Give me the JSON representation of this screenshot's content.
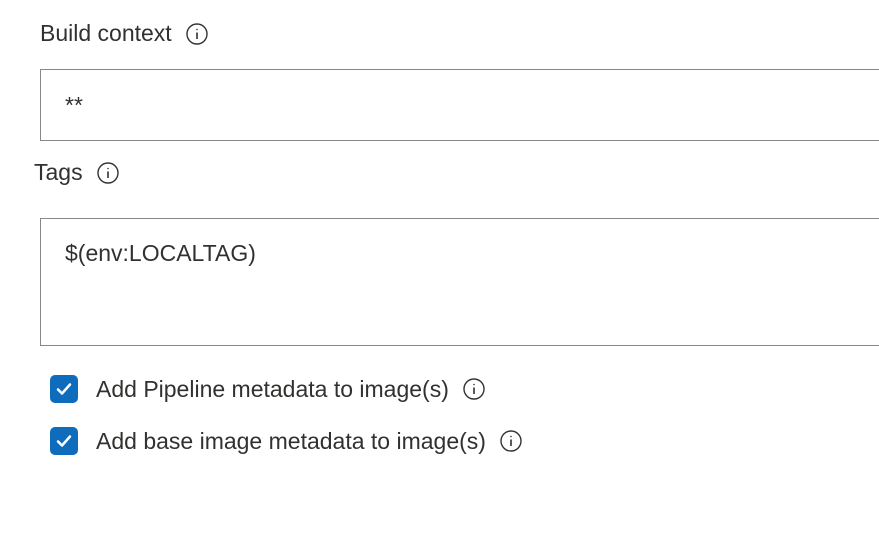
{
  "buildContext": {
    "label": "Build context",
    "value": "**"
  },
  "tags": {
    "label": "Tags",
    "value": "$(env:LOCALTAG)"
  },
  "checkboxes": {
    "pipelineMetadata": {
      "label": "Add Pipeline metadata to image(s)",
      "checked": true
    },
    "baseImageMetadata": {
      "label": "Add base image metadata to image(s)",
      "checked": true
    }
  }
}
